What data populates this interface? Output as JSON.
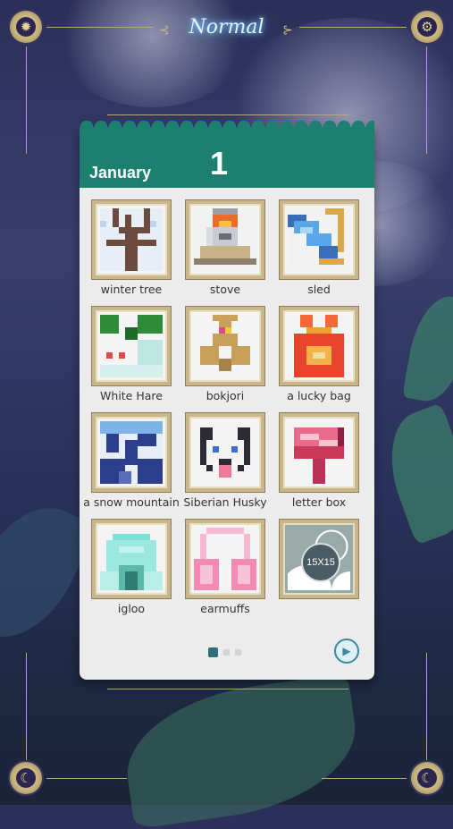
{
  "header": {
    "mode_title": "Normal",
    "settings_icon": "gear-icon",
    "sun_icon": "sun-icon"
  },
  "card": {
    "month": "January",
    "day": "1",
    "puzzles": [
      {
        "name": "winter tree",
        "state": "solved"
      },
      {
        "name": "stove",
        "state": "solved"
      },
      {
        "name": "sled",
        "state": "solved"
      },
      {
        "name": "White Hare",
        "state": "solved"
      },
      {
        "name": "bokjori",
        "state": "solved"
      },
      {
        "name": "a lucky bag",
        "state": "solved"
      },
      {
        "name": "a snow mountain",
        "state": "solved"
      },
      {
        "name": "Siberian Husky",
        "state": "solved"
      },
      {
        "name": "letter box",
        "state": "solved"
      },
      {
        "name": "igloo",
        "state": "solved"
      },
      {
        "name": "earmuffs",
        "state": "solved"
      },
      {
        "name": "",
        "state": "locked",
        "size_label": "15X15"
      }
    ],
    "pagination": {
      "current": 1,
      "total": 3
    },
    "next_icon": "play-icon"
  },
  "footer": {
    "left_icon": "moon-icon",
    "right_icon": "moon-icon"
  }
}
